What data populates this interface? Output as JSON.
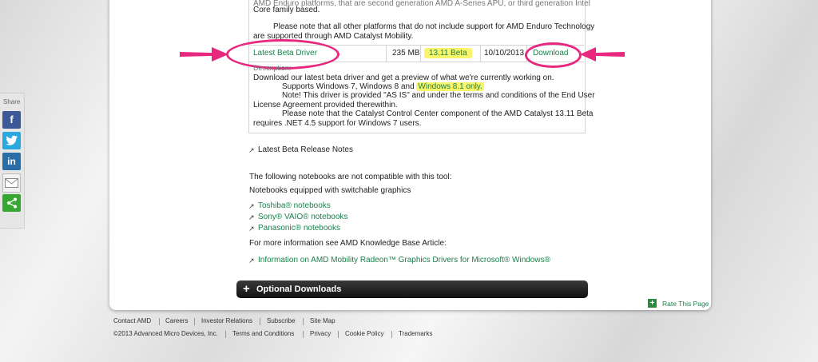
{
  "driver_box": {
    "intro_line1": "Core family based.",
    "note_line1": "Please note that all other platforms that do not include support for AMD Enduro Technology",
    "note_line2": "are supported through AMD Catalyst Mobility.",
    "row": {
      "name": "Latest Beta Driver",
      "size": "235 MB",
      "version": "13.11 Beta",
      "date": "10/10/2013",
      "download": "Download"
    },
    "desc_heading": "Description:",
    "desc1": "Download our latest beta driver and get a preview of what we're currently working on.",
    "desc2_pre": "Supports Windows 7, Windows 8 and ",
    "desc2_hl": "Windows 8.1 only.",
    "desc3": "Note! This driver is provided \"AS IS\" and under the terms and conditions of the End User",
    "desc4": "License Agreement provided therewithin.",
    "desc5": "Please note that the Catalyst Control Center component of the AMD Catalyst 13.11 Beta",
    "desc6": "requires .NET 4.5 support for Windows 7 users."
  },
  "release_notes": "Latest Beta Release Notes",
  "compat": {
    "line1": "The following notebooks are not compatible with this tool:",
    "line2": "Notebooks equipped with switchable graphics",
    "links": [
      "Toshiba® notebooks",
      "Sony® VAIO® notebooks",
      "Panasonic® notebooks"
    ],
    "kb_intro": "For more information see AMD Knowledge Base Article:",
    "kb_link": "Information on AMD Mobility Radeon™ Graphics Drivers for Microsoft® Windows®"
  },
  "optional_downloads": "Optional Downloads",
  "rate_page": "Rate This Page",
  "share": {
    "label": "Share",
    "buttons": [
      "facebook",
      "twitter",
      "linkedin",
      "email",
      "share"
    ]
  },
  "footer": {
    "row1": [
      "Contact AMD",
      "Careers",
      "Investor Relations",
      "Subscribe",
      "Site Map"
    ],
    "copyright": "©2013 Advanced Micro Devices, Inc.",
    "row2": [
      "Terms and Conditions",
      "Privacy",
      "Cookie Policy",
      "Trademarks"
    ]
  },
  "colors": {
    "link": "#1a7f4b",
    "highlight": "#f8f56a",
    "annotation": "#e8277f"
  }
}
